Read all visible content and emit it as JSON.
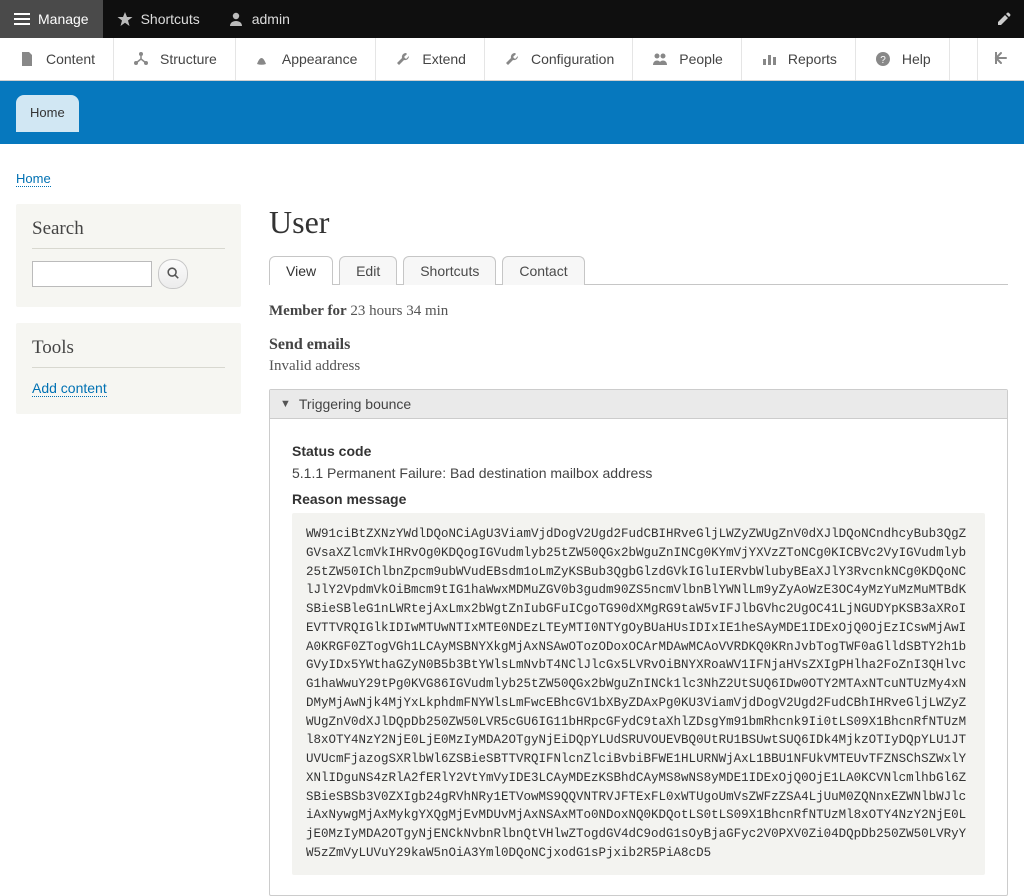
{
  "toolbar": {
    "manage": "Manage",
    "shortcuts": "Shortcuts",
    "user": "admin"
  },
  "admin_menu": {
    "content": "Content",
    "structure": "Structure",
    "appearance": "Appearance",
    "extend": "Extend",
    "configuration": "Configuration",
    "people": "People",
    "reports": "Reports",
    "help": "Help"
  },
  "home_tab": "Home",
  "breadcrumb": {
    "home": "Home"
  },
  "sidebar": {
    "search_heading": "Search",
    "tools_heading": "Tools",
    "add_content": "Add content"
  },
  "page": {
    "title": "User",
    "tabs": {
      "view": "View",
      "edit": "Edit",
      "shortcuts": "Shortcuts",
      "contact": "Contact"
    },
    "member_label": "Member for",
    "member_value": "23 hours 34 min",
    "send_emails_heading": "Send emails",
    "send_emails_value": "Invalid address",
    "details_summary": "Triggering bounce",
    "status_code_label": "Status code",
    "status_code_value": "5.1.1 Permanent Failure: Bad destination mailbox address",
    "reason_label": "Reason message",
    "reason_body": "WW91ciBtZXNzYWdlDQoNCiAgU3ViamVjdDogV2Ugd2FudCBIHRveGljLWZyZWUgZnV0dXJlDQoNCndhcyBub3QgZGVsaXZlcmVkIHRvOg0KDQogIGVudmlyb25tZW50QGx2bWguZnINCg0KYmVjYXVzZToNCg0KICBVc2VyIGVudmlyb25tZW50IChlbnZpcm9ubWVudEBsdm1oLmZyKSBub3QgbGlzdGVkIGluIERvbWlubyBEaXJlY3RvcnkNCg0KDQoNClJlY2VpdmVkOiBmcm9tIG1haWwxMDMuZGV0b3gudm90ZS5ncmVlbnBlYWNlLm9yZyAoWzE3OC4yMzYuMzMuMTBdKSBieSBleG1nLWRtejAxLmx2bWgtZnIubGFuICgoTG90dXMgRG9taW5vIFJlbGVhc2UgOC41LjNGUDYpKSB3aXRoIEVTTVRQIGlkIDIwMTUwNTIxMTE0NDEzLTEyMTI0NTYgOyBUaHUsIDIxIE1heSAyMDE1IDExOjQ0OjEzICswMjAwIA0KRGF0ZTogVGh1LCAyMSBNYXkgMjAxNSAwOTozODoxOCArMDAwMCAoVVRDKQ0KRnJvbTogTWF0aGlldSBTY2h1bGVyIDx5YWthaGZyN0B5b3BtYWlsLmNvbT4NClJlcGx5LVRvOiBNYXRoaWV1IFNjaHVsZXIgPHlha2FoZnI3QHlvcG1haWwuY29tPg0KVG86IGVudmlyb25tZW50QGx2bWguZnINCk1lc3NhZ2UtSUQ6IDw0OTY2MTAxNTcuNTUzMy4xNDMyMjAwNjk4MjYxLkphdmFNYWlsLmFwcEBhcGV1bXByZDAxPg0KU3ViamVjdDogV2Ugd2FudCBhIHRveGljLWZyZWUgZnV0dXJlDQpDb250ZW50LVR5cGU6IG11bHRpcGFydC9taXhlZDsgYm91bmRhcnk9Ii0tLS09X1BhcnRfNTUzMl8xOTY4NzY2NjE0LjE0MzIyMDA2OTgyNjEiDQpYLUdSRUVOUEVBQ0UtRU1BSUwtSUQ6IDk4MjkzOTIyDQpYLU1JTUVUcmFjazogSXRlbWl6ZSBieSBTTVRQIFNlcnZlciBvbiBFWE1HLURNWjAxL1BBU1NFUkVMTEUvTFZNSChSZWxlYXNlIDguNS4zRlA2fERlY2VtYmVyIDE3LCAyMDEzKSBhdCAyMS8wNS8yMDE1IDExOjQ0OjE1LA0KCVNlcmlhbGl6ZSBieSBSb3V0ZXIgb24gRVhNRy1ETVowMS9QQVNTRVJFTExFL0xWTUgoUmVsZWFzZSA4LjUuM0ZQNnxEZWNlbWJlciAxNywgMjAxMykgYXQgMjEvMDUvMjAxNSAxMTo0NDoxNQ0KDQotLS0tLS09X1BhcnRfNTUzMl8xOTY4NzY2NjE0LjE0MzIyMDA2OTgyNjENCkNvbnRlbnQtVHlwZTogdGV4dC9odG1sOyBjaGFyc2V0PXV0Zi04DQpDb250ZW50LVRyYW5zZmVyLUVuY29kaW5nOiA3Yml0DQoNCjxodG1sPjxib2R5PiA8cD5"
  }
}
